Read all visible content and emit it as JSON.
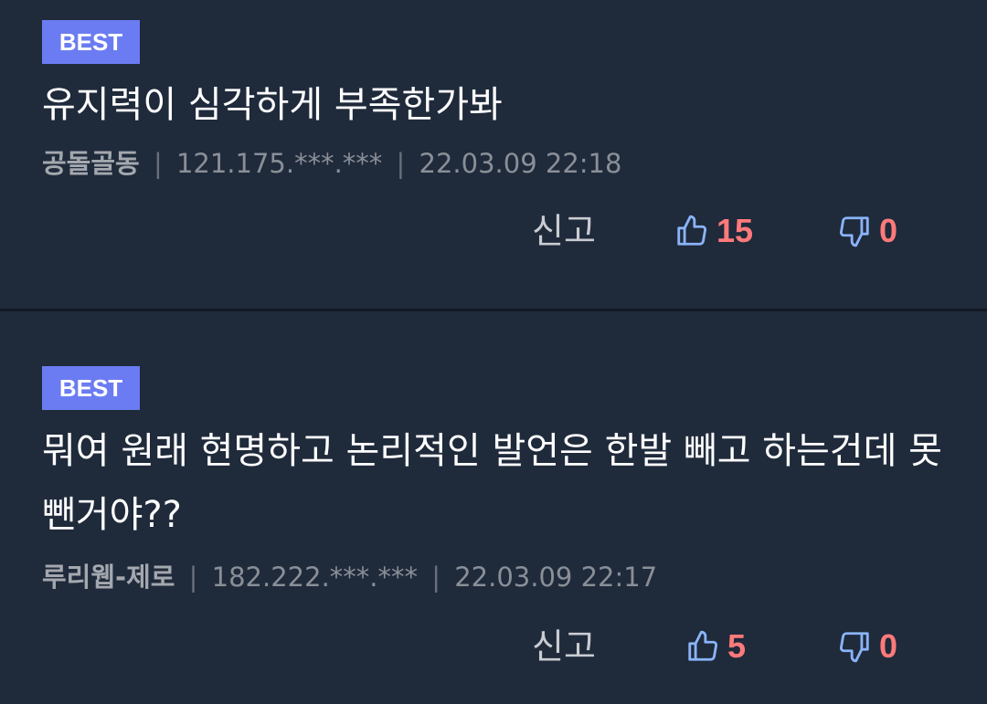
{
  "comments": [
    {
      "badge": "BEST",
      "text": "유지력이 심각하게 부족한가봐",
      "author": "공돌골동",
      "ip": "121.175.***.***",
      "time": "22.03.09 22:18",
      "report_label": "신고",
      "likes": "15",
      "dislikes": "0"
    },
    {
      "badge": "BEST",
      "text": "뭐여 원래 현명하고 논리적인 발언은 한발 빼고 하는건데 못뺀거야??",
      "author": "루리웹-제로",
      "ip": "182.222.***.***",
      "time": "22.03.09 22:17",
      "report_label": "신고",
      "likes": "5",
      "dislikes": "0"
    }
  ],
  "meta_separator": "|",
  "colors": {
    "background": "#1f2a3b",
    "badge": "#6b7cf2",
    "count": "#ff7a7a",
    "icon": "#8ab4f8"
  },
  "icons": {
    "up": "thumbs-up-icon",
    "down": "thumbs-down-icon"
  }
}
